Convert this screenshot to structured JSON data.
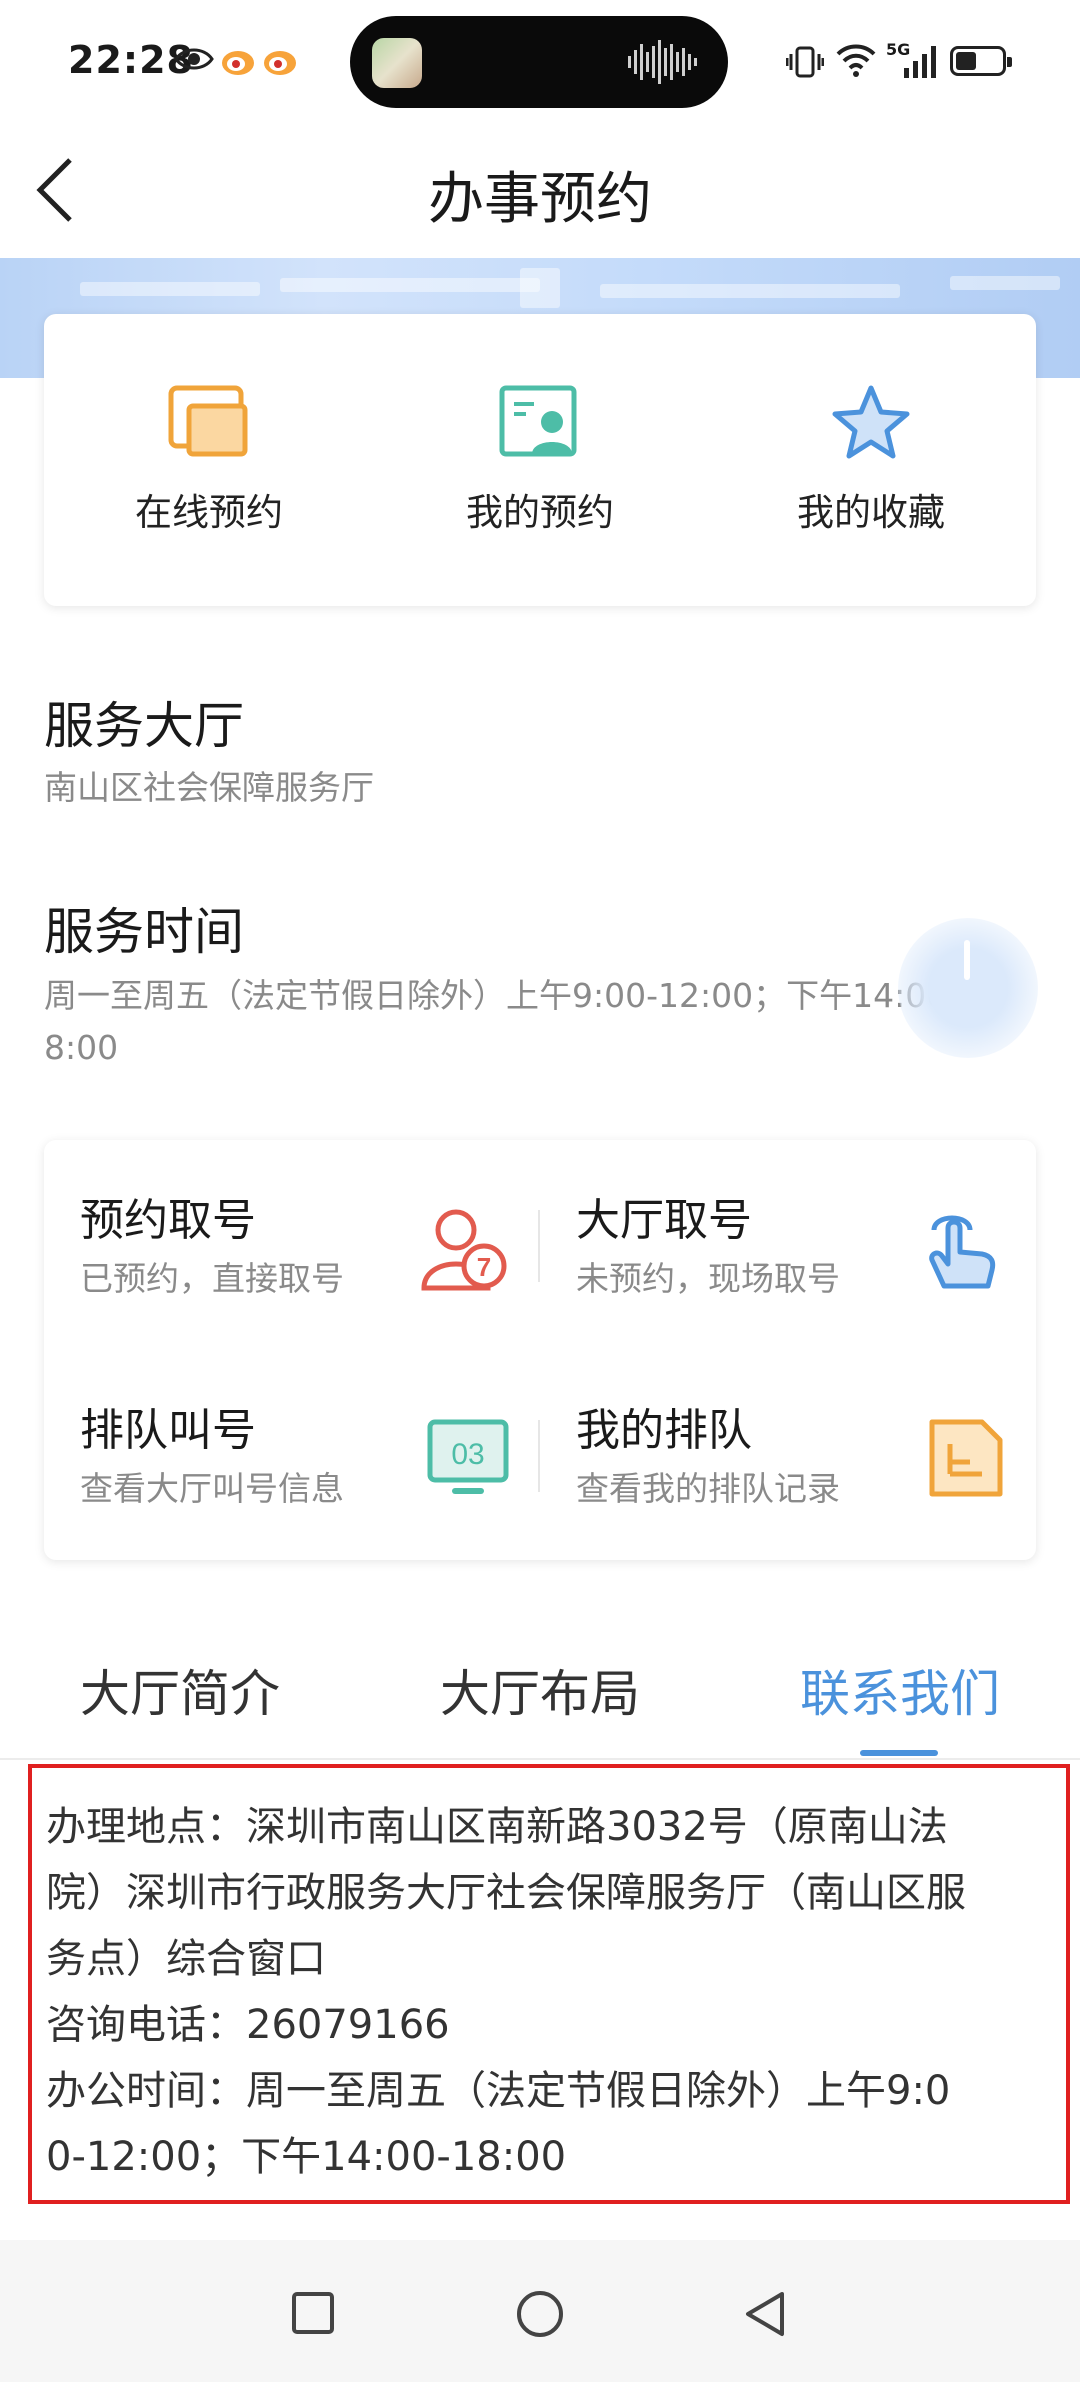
{
  "status_bar": {
    "time": "22:28",
    "network": "5G"
  },
  "nav": {
    "title": "办事预约"
  },
  "quick_actions": [
    {
      "label": "在线预约",
      "icon": "online-booking-icon"
    },
    {
      "label": "我的预约",
      "icon": "my-booking-icon"
    },
    {
      "label": "我的收藏",
      "icon": "star-icon"
    }
  ],
  "hall": {
    "heading": "服务大厅",
    "name": "南山区社会保障服务厅"
  },
  "service_time": {
    "heading": "服务时间",
    "line1": "周一至周五（法定节假日除外）上午9:00-12:00；下午14:00-1",
    "line2": "8:00"
  },
  "services": [
    {
      "title": "预约取号",
      "sub": "已预约，直接取号",
      "icon": "appointment-number-icon"
    },
    {
      "title": "大厅取号",
      "sub": "未预约，现场取号",
      "icon": "hand-tap-icon"
    },
    {
      "title": "排队叫号",
      "sub": "查看大厅叫号信息",
      "icon": "queue-display-icon",
      "icon_text": "03"
    },
    {
      "title": "我的排队",
      "sub": "查看我的排队记录",
      "icon": "queue-record-icon"
    }
  ],
  "tabs": [
    {
      "label": "大厅简介",
      "active": false
    },
    {
      "label": "大厅布局",
      "active": false
    },
    {
      "label": "联系我们",
      "active": true
    }
  ],
  "contact": {
    "lines": [
      "办理地点：深圳市南山区南新路3032号（原南山法",
      "院）深圳市行政服务大厅社会保障服务厅（南山区服",
      "务点）综合窗口",
      "咨询电话：26079166",
      "办公时间：周一至周五（法定节假日除外）上午9:0",
      "0-12:00；下午14:00-18:00"
    ]
  },
  "colors": {
    "accent": "#4b92dc",
    "highlight_border": "#e02020",
    "orange": "#f0a43a",
    "teal": "#4dbda7",
    "red": "#e25b4e"
  }
}
